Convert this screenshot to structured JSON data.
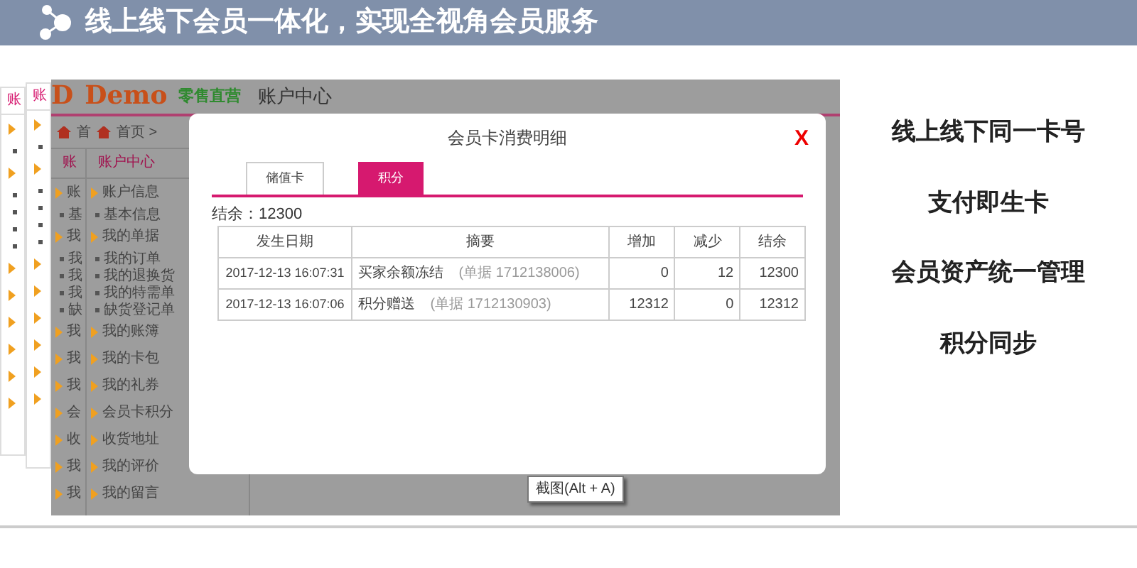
{
  "slide": {
    "title": "线上线下会员一体化，实现全视角会员服务"
  },
  "back_panels": [
    {
      "tab": "账",
      "items": [
        {
          "kind": "arrow"
        },
        {
          "kind": "dot"
        },
        {
          "kind": "arrow"
        },
        {
          "kind": "dot"
        },
        {
          "kind": "dot"
        },
        {
          "kind": "dot"
        },
        {
          "kind": "dot"
        },
        {
          "kind": "arrow"
        },
        {
          "kind": "arrow"
        },
        {
          "kind": "arrow"
        },
        {
          "kind": "arrow"
        },
        {
          "kind": "arrow"
        },
        {
          "kind": "arrow"
        }
      ]
    },
    {
      "tab": "账",
      "items": [
        {
          "kind": "arrow"
        },
        {
          "kind": "dot"
        },
        {
          "kind": "arrow"
        },
        {
          "kind": "dot"
        },
        {
          "kind": "dot"
        },
        {
          "kind": "dot"
        },
        {
          "kind": "dot"
        },
        {
          "kind": "arrow"
        },
        {
          "kind": "arrow"
        },
        {
          "kind": "arrow"
        },
        {
          "kind": "arrow"
        },
        {
          "kind": "arrow"
        },
        {
          "kind": "arrow"
        }
      ]
    }
  ],
  "app": {
    "partial_logo": "D",
    "logo": "Demo",
    "brand": "零售直营",
    "page_title": "账户中心",
    "breadcrumb_partial": "首",
    "breadcrumb": "首页 >",
    "partial_sidebar": {
      "header": "账",
      "items": [
        {
          "label": "账",
          "kind": "arrow"
        },
        {
          "label": "基",
          "kind": "dot"
        },
        {
          "label": "我",
          "kind": "arrow"
        },
        {
          "label": "我",
          "kind": "dot"
        },
        {
          "label": "我",
          "kind": "dot"
        },
        {
          "label": "我",
          "kind": "dot"
        },
        {
          "label": "缺",
          "kind": "dot"
        },
        {
          "label": "我",
          "kind": "arrow"
        },
        {
          "label": "我",
          "kind": "arrow"
        },
        {
          "label": "我",
          "kind": "arrow"
        },
        {
          "label": "会",
          "kind": "arrow"
        },
        {
          "label": "收",
          "kind": "arrow"
        },
        {
          "label": "我",
          "kind": "arrow"
        },
        {
          "label": "我",
          "kind": "arrow"
        }
      ]
    },
    "sidebar": {
      "header": "账户中心",
      "items": [
        {
          "label": "账户信息",
          "kind": "arrow"
        },
        {
          "label": "基本信息",
          "kind": "dot"
        },
        {
          "label": "我的单据",
          "kind": "arrow"
        },
        {
          "label": "我的订单",
          "kind": "dot"
        },
        {
          "label": "我的退换货",
          "kind": "dot"
        },
        {
          "label": "我的特需单",
          "kind": "dot"
        },
        {
          "label": "缺货登记单",
          "kind": "dot"
        },
        {
          "label": "我的账簿",
          "kind": "arrow"
        },
        {
          "label": "我的卡包",
          "kind": "arrow"
        },
        {
          "label": "我的礼券",
          "kind": "arrow"
        },
        {
          "label": "会员卡积分",
          "kind": "arrow"
        },
        {
          "label": "收货地址",
          "kind": "arrow"
        },
        {
          "label": "我的评价",
          "kind": "arrow"
        },
        {
          "label": "我的留言",
          "kind": "arrow"
        }
      ]
    }
  },
  "modal": {
    "title": "会员卡消费明细",
    "close": "X",
    "tabs": [
      {
        "label": "储值卡",
        "selected": false
      },
      {
        "label": "积分",
        "selected": true
      }
    ],
    "balance": "结余：12300",
    "table": {
      "columns": [
        "发生日期",
        "摘要",
        "增加",
        "减少",
        "结余"
      ],
      "rows": [
        {
          "date": "2017-12-13 16:07:31",
          "summary": "买家余额冻结",
          "note": "(单据 1712138006)",
          "increase": "0",
          "decrease": "12",
          "balance": "12300"
        },
        {
          "date": "2017-12-13 16:07:06",
          "summary": "积分赠送",
          "note": "(单据 1712130903)",
          "increase": "12312",
          "decrease": "0",
          "balance": "12312"
        }
      ]
    }
  },
  "tooltip": "截图(Alt + A)",
  "features": [
    "线上线下同一卡号",
    "支付即生卡",
    "会员资产统一管理",
    "积分同步"
  ]
}
